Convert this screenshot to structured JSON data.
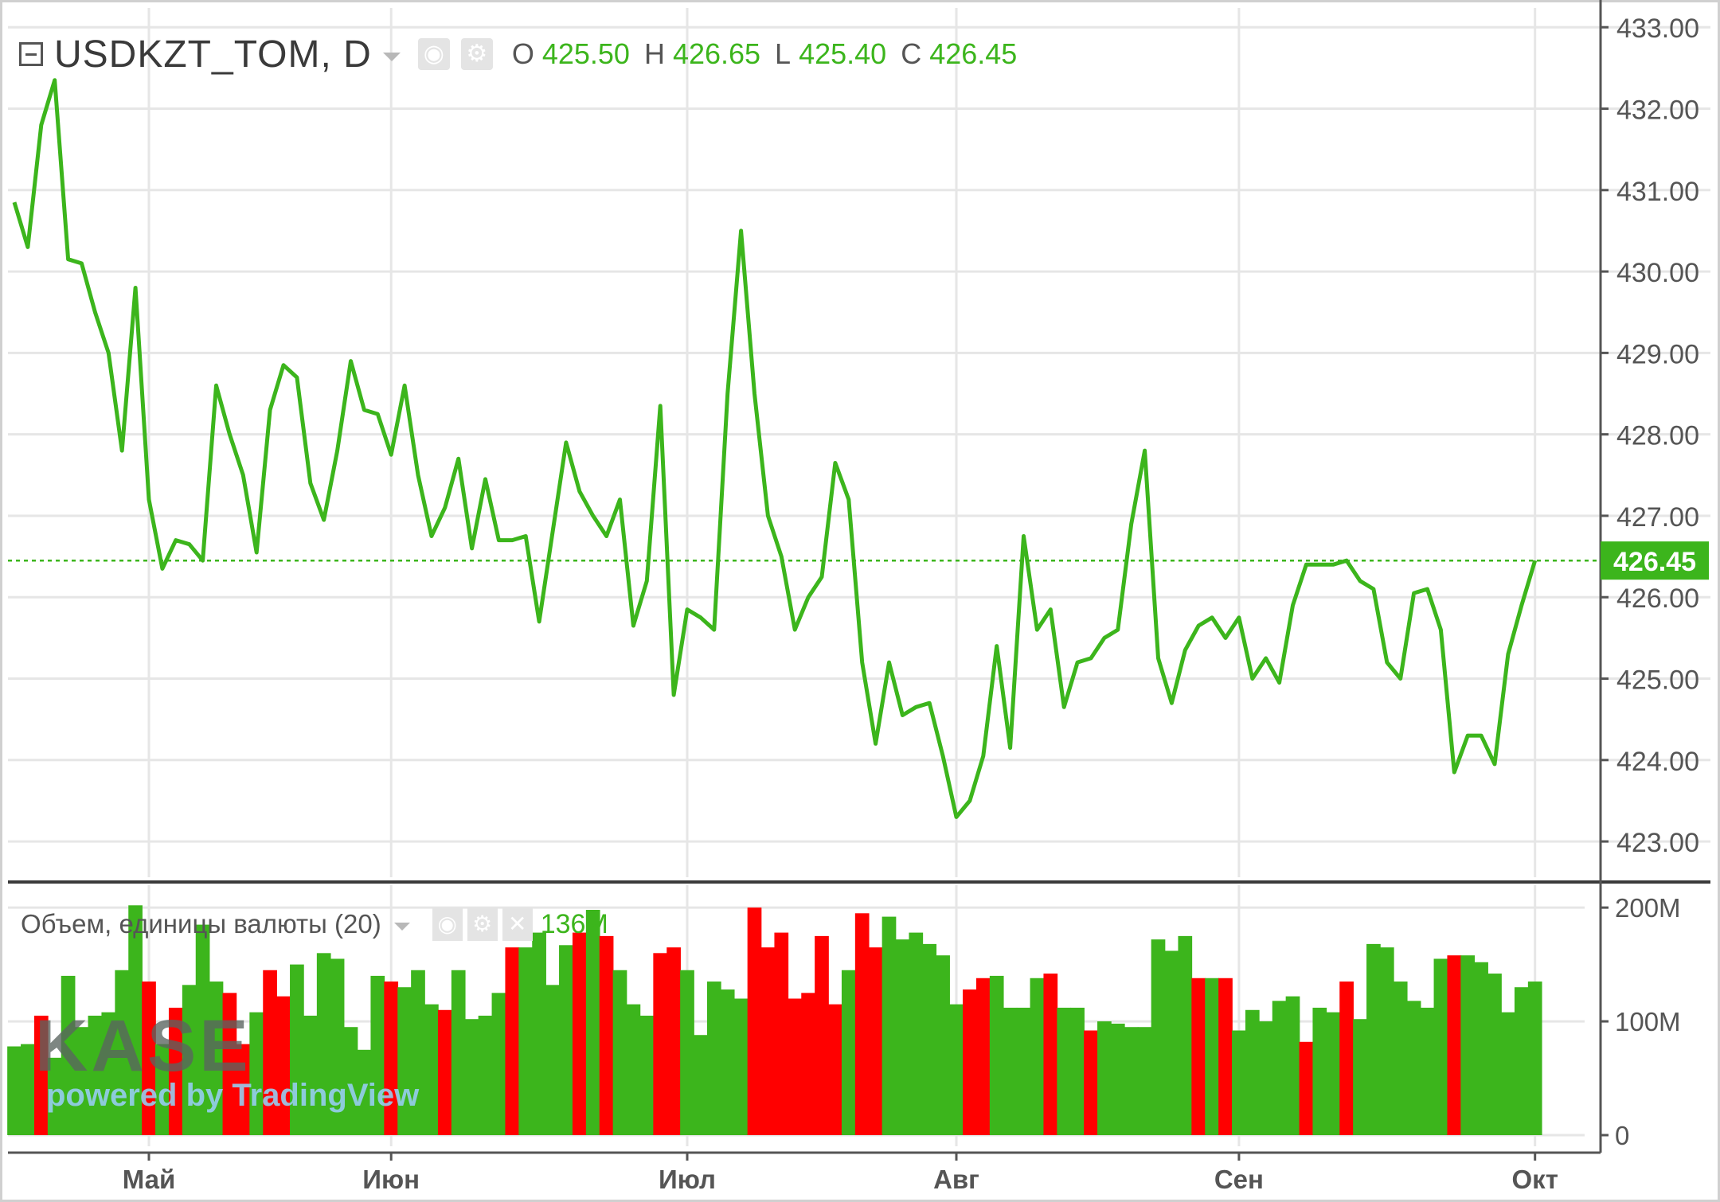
{
  "header": {
    "symbol": "USDKZT_TOM, D",
    "ohlc": [
      {
        "label": "O",
        "value": "425.50"
      },
      {
        "label": "H",
        "value": "426.65"
      },
      {
        "label": "L",
        "value": "425.40"
      },
      {
        "label": "C",
        "value": "426.45"
      }
    ]
  },
  "volume_legend": {
    "title": "Объем, единицы валюты (20)",
    "value": "136M"
  },
  "logo": {
    "main": "KASE",
    "sub": "powered by TradingView"
  },
  "colors": {
    "up": "#3cb51c",
    "down": "#ff0000",
    "line": "#3cb51c",
    "grid": "#e6e6e6"
  },
  "icons": [
    "collapse-icon",
    "eye-icon",
    "gear-icon",
    "close-icon",
    "dropdown-caret-icon"
  ],
  "chart_data": [
    {
      "type": "line",
      "title": "USDKZT_TOM, D",
      "ylim": [
        422.6,
        433.1
      ],
      "y_ticks": [
        "423.00",
        "424.00",
        "425.00",
        "426.00",
        "427.00",
        "428.00",
        "429.00",
        "430.00",
        "431.00",
        "432.00",
        "433.00"
      ],
      "y_tick_values": [
        423,
        424,
        425,
        426,
        427,
        428,
        429,
        430,
        431,
        432,
        433
      ],
      "x_labels": [
        "Май",
        "Июн",
        "Июл",
        "Авг",
        "Сен",
        "Окт"
      ],
      "x_label_bar_index": [
        10,
        28,
        50,
        70,
        91,
        113
      ],
      "last_price": "426.45",
      "series": [
        {
          "values": [
            430.85,
            430.3,
            431.8,
            432.35,
            430.15,
            430.1,
            429.5,
            429.0,
            427.8,
            429.8,
            427.2,
            426.35,
            426.7,
            426.65,
            426.45,
            428.6,
            428.0,
            427.5,
            426.55,
            428.3,
            428.85,
            428.7,
            427.4,
            426.95,
            427.8,
            428.9,
            428.3,
            428.25,
            427.75,
            428.6,
            427.5,
            426.75,
            427.1,
            427.7,
            426.6,
            427.45,
            426.7,
            426.7,
            426.75,
            425.7,
            426.8,
            427.9,
            427.3,
            427.0,
            426.75,
            427.2,
            425.65,
            426.2,
            428.35,
            424.8,
            425.85,
            425.75,
            425.6,
            428.5,
            430.5,
            428.5,
            427.0,
            426.5,
            425.6,
            426.0,
            426.25,
            427.65,
            427.2,
            425.2,
            424.2,
            425.2,
            424.55,
            424.65,
            424.7,
            424.05,
            423.3,
            423.5,
            424.05,
            425.4,
            424.15,
            426.75,
            425.6,
            425.85,
            424.65,
            425.2,
            425.25,
            425.5,
            425.6,
            426.9,
            427.8,
            425.25,
            424.7,
            425.35,
            425.65,
            425.75,
            425.5,
            425.75,
            425.0,
            425.25,
            424.95,
            425.9,
            426.4,
            426.4,
            426.4,
            426.45,
            426.2,
            426.1,
            425.2,
            425.0,
            426.05,
            426.1,
            425.6,
            423.85,
            424.3,
            424.3,
            423.95,
            425.3,
            425.9,
            426.45
          ]
        }
      ]
    },
    {
      "type": "bar",
      "title": "Объем, единицы валюты (20)",
      "ylim": [
        0,
        205
      ],
      "y_ticks": [
        "0",
        "100M",
        "200M"
      ],
      "y_tick_values": [
        0,
        100,
        200
      ],
      "value_unit": "M",
      "series": [
        {
          "name": "Объем, единицы валюты (20)",
          "values": [
            78,
            80,
            105,
            68,
            140,
            95,
            105,
            108,
            145,
            202,
            135,
            80,
            112,
            132,
            185,
            135,
            125,
            80,
            108,
            145,
            122,
            150,
            105,
            160,
            155,
            95,
            75,
            140,
            135,
            130,
            145,
            115,
            110,
            145,
            102,
            105,
            125,
            165,
            165,
            178,
            132,
            167,
            178,
            198,
            175,
            145,
            115,
            105,
            160,
            165,
            145,
            88,
            135,
            128,
            120,
            200,
            165,
            178,
            120,
            125,
            175,
            115,
            145,
            195,
            165,
            192,
            172,
            178,
            168,
            158,
            115,
            128,
            138,
            140,
            112,
            112,
            138,
            142,
            112,
            112,
            92,
            100,
            98,
            95,
            95,
            172,
            162,
            175,
            138,
            138,
            138,
            92,
            110,
            100,
            118,
            122,
            82,
            112,
            108,
            135,
            102,
            168,
            165,
            135,
            118,
            112,
            155,
            158,
            158,
            152,
            142,
            108,
            130,
            135
          ],
          "colors": "ggrgggggggrgrgggrrgrrgggggggrgggrggggrggggrgrgggrrgggggrrrrrrrgrrggggggrrggggrggrgggggggrgrgggggrggrgggggggrgggggg"
        }
      ]
    }
  ]
}
